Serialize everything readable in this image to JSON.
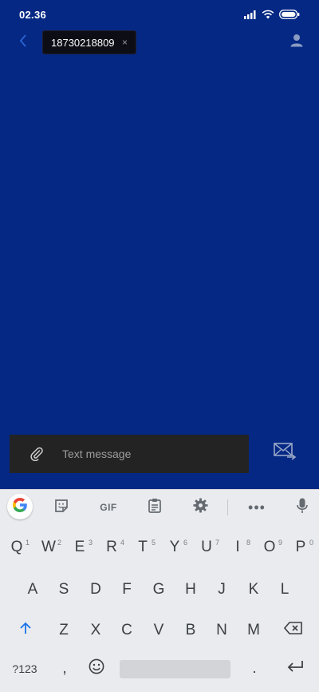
{
  "status_bar": {
    "time": "02.36",
    "icons": [
      "signal-icon",
      "wifi-icon",
      "battery-icon"
    ]
  },
  "top_bar": {
    "recipient": "18730218809",
    "chip_close": "×",
    "back_icon": "chevron-left-icon",
    "contact_icon": "person-icon"
  },
  "compose": {
    "placeholder": "Text message",
    "attach_icon": "paperclip-icon",
    "send_icon": "send-sms-icon"
  },
  "keyboard": {
    "toolbar": {
      "google": "google-g-icon",
      "sticker": "sticker-icon",
      "gif": "GIF",
      "clipboard": "clipboard-icon",
      "settings": "gear-icon",
      "more": "•••",
      "mic": "microphone-icon"
    },
    "row1": [
      {
        "label": "Q",
        "hint": "1"
      },
      {
        "label": "W",
        "hint": "2"
      },
      {
        "label": "E",
        "hint": "3"
      },
      {
        "label": "R",
        "hint": "4"
      },
      {
        "label": "T",
        "hint": "5"
      },
      {
        "label": "Y",
        "hint": "6"
      },
      {
        "label": "U",
        "hint": "7"
      },
      {
        "label": "I",
        "hint": "8"
      },
      {
        "label": "O",
        "hint": "9"
      },
      {
        "label": "P",
        "hint": "0"
      }
    ],
    "row2": [
      "A",
      "S",
      "D",
      "F",
      "G",
      "H",
      "J",
      "K",
      "L"
    ],
    "row3": [
      "Z",
      "X",
      "C",
      "V",
      "B",
      "N",
      "M"
    ],
    "row4": {
      "symbols": "?123",
      "comma": ",",
      "period": "."
    }
  },
  "colors": {
    "background": "#052884",
    "compose_bg": "#232323",
    "keyboard_bg": "#e9ebee",
    "shift_active": "#1a73e8"
  }
}
